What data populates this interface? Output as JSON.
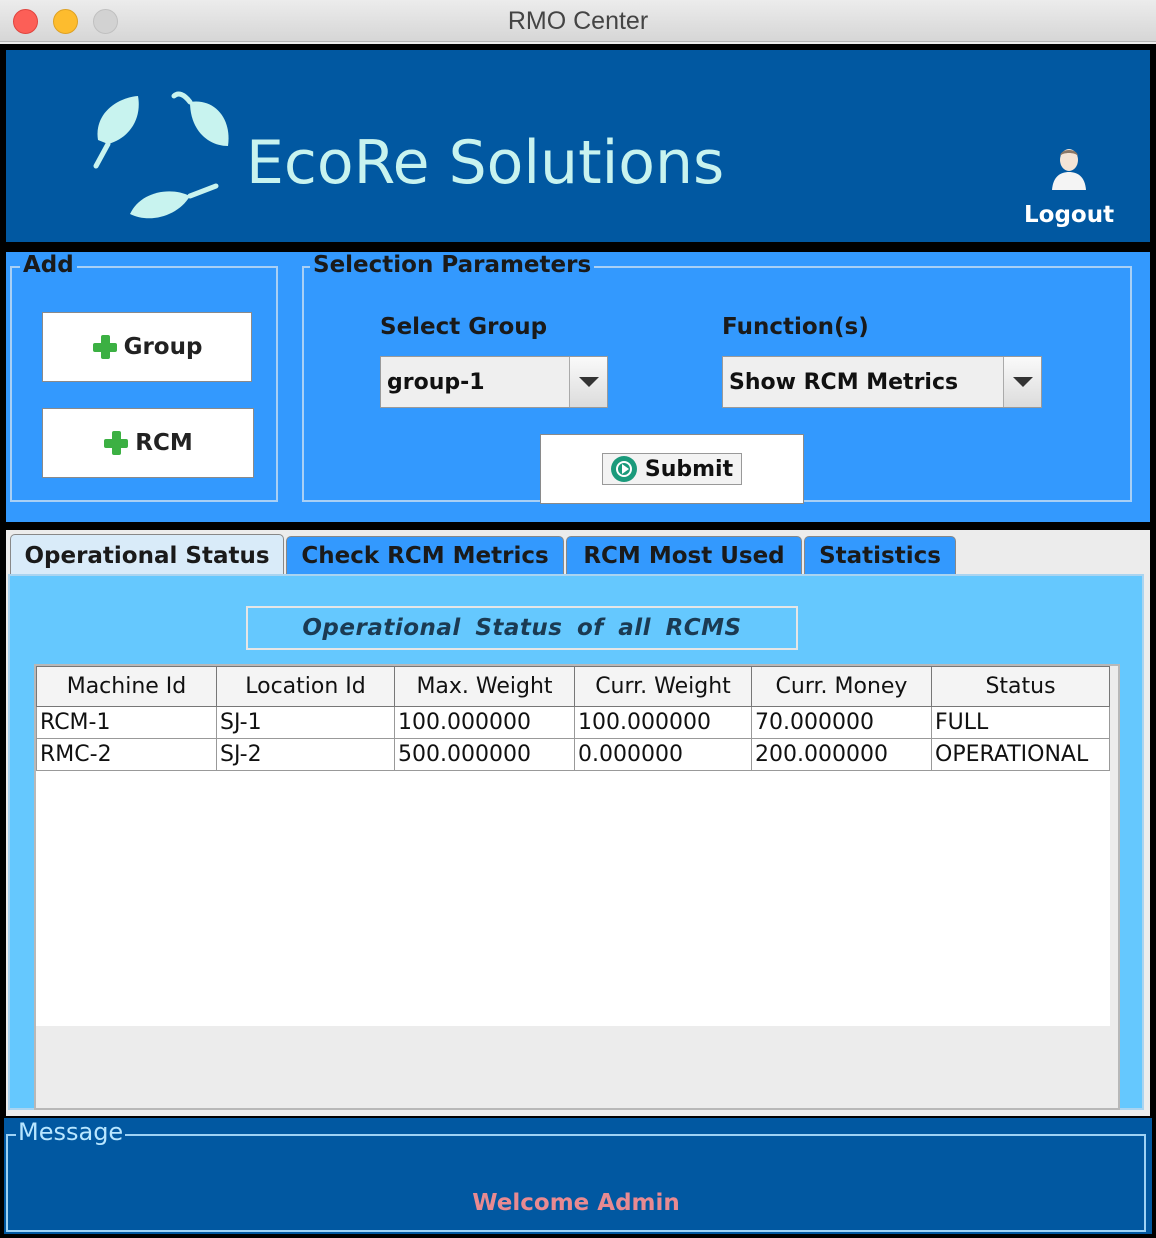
{
  "window": {
    "title": "RMO Center"
  },
  "header": {
    "brand": "EcoRe Solutions",
    "logout_label": "Logout"
  },
  "add": {
    "legend": "Add",
    "group_button": "Group",
    "rcm_button": "RCM"
  },
  "selection": {
    "legend": "Selection Parameters",
    "group_label": "Select Group",
    "group_value": "group-1",
    "function_label": "Function(s)",
    "function_value": "Show RCM Metrics",
    "submit_label": "Submit"
  },
  "tabs": [
    {
      "label": "Operational Status",
      "active": true
    },
    {
      "label": "Check RCM Metrics",
      "active": false
    },
    {
      "label": "RCM Most Used",
      "active": false
    },
    {
      "label": "Statistics",
      "active": false
    }
  ],
  "panel": {
    "title": "Operational Status of all RCMS"
  },
  "table": {
    "columns": [
      "Machine Id",
      "Location Id",
      "Max. Weight",
      "Curr. Weight",
      "Curr. Money",
      "Status"
    ],
    "rows": [
      [
        "RCM-1",
        "SJ-1",
        "100.000000",
        "100.000000",
        "70.000000",
        "FULL"
      ],
      [
        "RMC-2",
        "SJ-2",
        "500.000000",
        "0.000000",
        "200.000000",
        "OPERATIONAL"
      ]
    ]
  },
  "message": {
    "legend": "Message",
    "text": "Welcome Admin"
  },
  "colors": {
    "header_bg": "#0158a1",
    "panel_bg": "#3399fe",
    "tab_panel_bg": "#65c8fe",
    "message_text": "#e88a91"
  }
}
